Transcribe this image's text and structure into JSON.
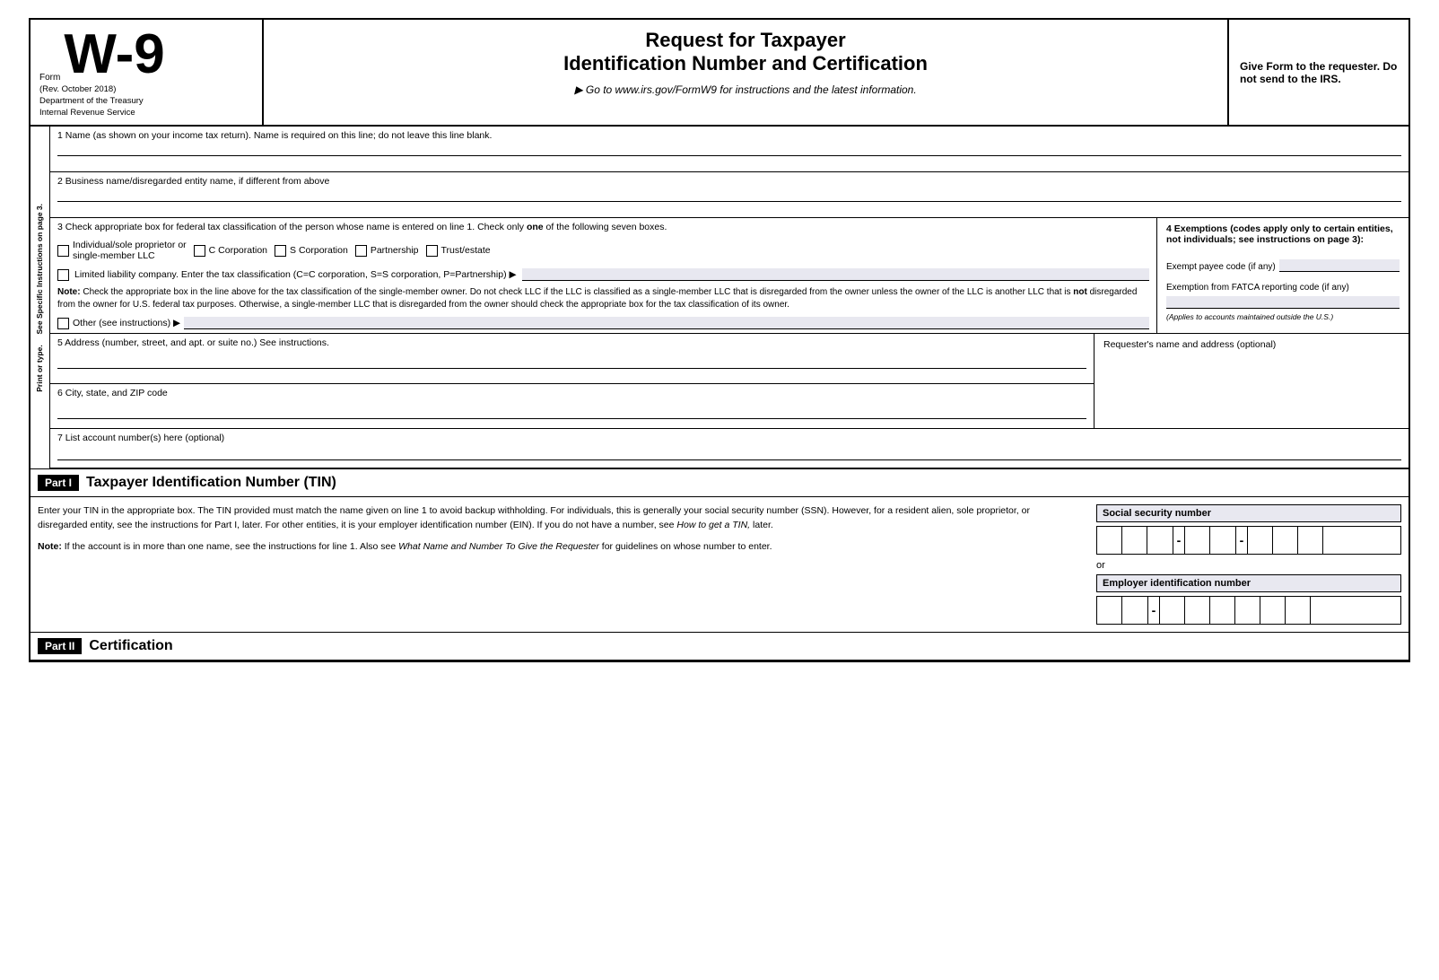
{
  "header": {
    "form_label": "Form",
    "form_number": "W-9",
    "form_rev": "(Rev. October 2018)",
    "form_dept": "Department of the Treasury",
    "form_service": "Internal Revenue Service",
    "title_line1": "Request for Taxpayer",
    "title_line2": "Identification Number and Certification",
    "go_to": "▶ Go to www.irs.gov/FormW9 for instructions and the latest information.",
    "give_form": "Give Form to the requester. Do not send to the IRS."
  },
  "side_label": {
    "line1": "Print or type.",
    "line2": "See Specific Instructions on page 3."
  },
  "row1": {
    "label": "1  Name (as shown on your income tax return). Name is required on this line; do not leave this line blank."
  },
  "row2": {
    "label": "2  Business name/disregarded entity name, if different from above"
  },
  "row3": {
    "label_start": "3  Check appropriate box for federal tax classification of the person whose name is entered on line 1. Check only ",
    "label_one": "one",
    "label_end": " of the following seven boxes.",
    "checkboxes": [
      {
        "id": "indiv",
        "label": "Individual/sole proprietor or single-member LLC"
      },
      {
        "id": "ccorp",
        "label": "C Corporation"
      },
      {
        "id": "scorp",
        "label": "S Corporation"
      },
      {
        "id": "partner",
        "label": "Partnership"
      },
      {
        "id": "trust",
        "label": "Trust/estate"
      }
    ],
    "llc_label": "Limited liability company. Enter the tax classification (C=C corporation, S=S corporation, P=Partnership) ▶",
    "note_bold": "Note:",
    "note_text": " Check the appropriate box in the line above for the tax classification of the single-member owner. Do not check LLC if the LLC is classified as a single-member LLC that is disregarded from the owner unless the owner of the LLC is another LLC that is ",
    "not_bold": "not",
    "note_text2": " disregarded from the owner for U.S. federal tax purposes. Otherwise, a single-member LLC that is disregarded from the owner should check the appropriate box for the tax classification of its owner.",
    "other_label": "Other (see instructions) ▶",
    "exemptions_header": "4  Exemptions (codes apply only to certain entities, not individuals; see instructions on page 3):",
    "exempt_payee_label": "Exempt payee code (if any)",
    "fatca_label": "Exemption from FATCA reporting code (if any)",
    "applies_note": "(Applies to accounts maintained outside the U.S.)"
  },
  "row5": {
    "label": "5  Address (number, street, and apt. or suite no.) See instructions.",
    "requester_label": "Requester's name and address (optional)"
  },
  "row6": {
    "label": "6  City, state, and ZIP code"
  },
  "row7": {
    "label": "7  List account number(s) here (optional)"
  },
  "part1": {
    "badge": "Part I",
    "title": "Taxpayer Identification Number (TIN)",
    "text1": "Enter your TIN in the appropriate box. The TIN provided must match the name given on line 1 to avoid backup withholding. For individuals, this is generally your social security number (SSN). However, for a resident alien, sole proprietor, or disregarded entity, see the instructions for Part I, later. For other entities, it is your employer identification number (EIN). If you do not have a number, see ",
    "text_italic": "How to get a TIN,",
    "text2": " later.",
    "note_bold": "Note:",
    "note_text": " If the account is in more than one name, see the instructions for line 1. Also see ",
    "note_italic": "What Name and Number To Give the Requester",
    "note_text2": " for guidelines on whose number to enter.",
    "ssn_label": "Social security number",
    "ssn_cells_group1": 3,
    "ssn_cells_group2": 2,
    "ssn_cells_group3": 4,
    "or_label": "or",
    "ein_label": "Employer identification number",
    "ein_cells_group1": 2,
    "ein_cells_group2": 7
  },
  "part2": {
    "badge": "Part II",
    "title": "Certification"
  }
}
